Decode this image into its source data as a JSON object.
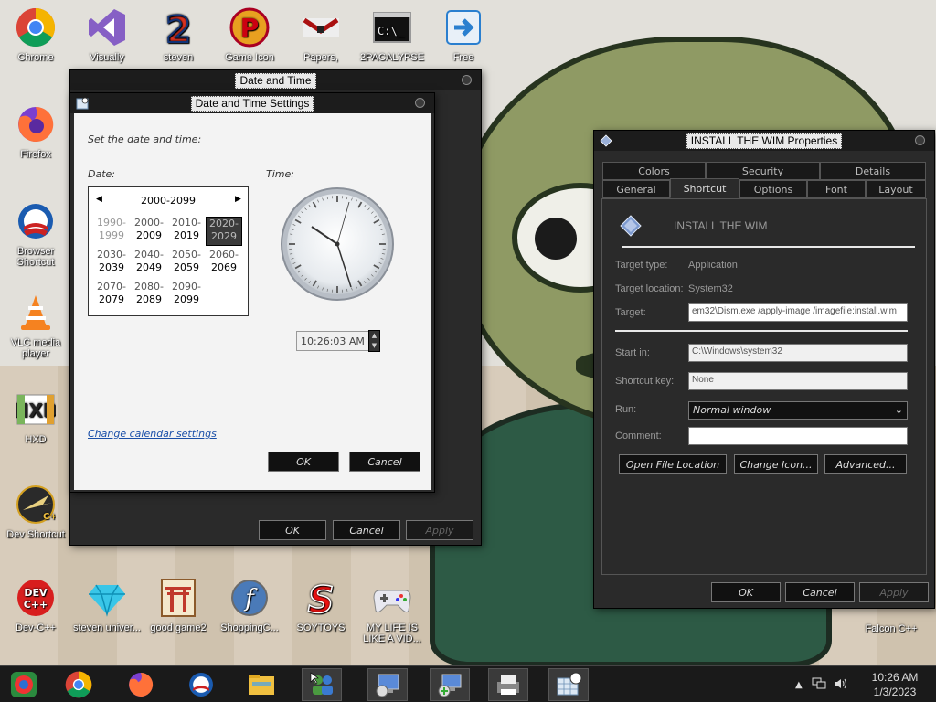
{
  "desktop_icons": [
    {
      "label": "Chrome",
      "icon": "chrome-icon"
    },
    {
      "label": "Visually",
      "icon": "visual-studio-icon"
    },
    {
      "label": "steven",
      "icon": "game-2-icon"
    },
    {
      "label": "Game Icon",
      "icon": "p-game-icon"
    },
    {
      "label": "Papers,",
      "icon": "papers-please-icon"
    },
    {
      "label": "2PACALYPSE",
      "icon": "cmd-icon"
    },
    {
      "label": "Free",
      "icon": "free-arrow-icon"
    },
    {
      "label": "Firefox",
      "icon": "firefox-icon"
    },
    {
      "label": "Browser Shortcut",
      "icon": "obama-icon"
    },
    {
      "label": "VLC media player",
      "icon": "vlc-icon"
    },
    {
      "label": "HXD",
      "icon": "hxd-icon"
    },
    {
      "label": "Dev Shortcut",
      "icon": "c-plus-plus-icon"
    },
    {
      "label": "Dev-C++",
      "icon": "dev-cpp-icon"
    },
    {
      "label": "steven univer...",
      "icon": "gem-icon"
    },
    {
      "label": "good game2",
      "icon": "torii-icon"
    },
    {
      "label": "ShoppingC...",
      "icon": "flash-icon"
    },
    {
      "label": "SOYTOYS",
      "icon": "s-logo-icon"
    },
    {
      "label": "MY LIFE IS LIKE A VID...",
      "icon": "gamepad-icon"
    },
    {
      "label": "Falcon C++",
      "icon": "falcon-icon"
    }
  ],
  "date_time_window": {
    "title": "Date and Time",
    "buttons": {
      "ok": "OK",
      "cancel": "Cancel",
      "apply": "Apply"
    }
  },
  "date_time_settings": {
    "title": "Date and Time Settings",
    "prompt": "Set the date and time:",
    "date_label": "Date:",
    "time_label": "Time:",
    "calendar": {
      "header": "2000-2099",
      "cells": [
        {
          "top": "1990-",
          "bottom": "1999",
          "dim": true
        },
        {
          "top": "2000-",
          "bottom": "2009",
          "dim": false
        },
        {
          "top": "2010-",
          "bottom": "2019",
          "dim": false
        },
        {
          "top": "2020-",
          "bottom": "2029",
          "selected": true
        },
        {
          "top": "2030-",
          "bottom": "2039",
          "dim": false
        },
        {
          "top": "2040-",
          "bottom": "2049",
          "dim": false
        },
        {
          "top": "2050-",
          "bottom": "2059",
          "dim": false
        },
        {
          "top": "2060-",
          "bottom": "2069",
          "dim": false
        },
        {
          "top": "2070-",
          "bottom": "2079",
          "dim": false
        },
        {
          "top": "2080-",
          "bottom": "2089",
          "dim": false
        },
        {
          "top": "2090-",
          "bottom": "2099",
          "dim": false
        }
      ]
    },
    "time_value": "10:26:03 AM",
    "change_link": "Change calendar settings",
    "ok": "OK",
    "cancel": "Cancel"
  },
  "properties_window": {
    "title": "INSTALL THE WIM Properties",
    "tabs_row1": [
      "Colors",
      "Security",
      "Details"
    ],
    "tabs_row2": [
      "General",
      "Shortcut",
      "Options",
      "Font",
      "Layout"
    ],
    "active_tab": "Shortcut",
    "shortcut_name": "INSTALL THE WIM",
    "fields": {
      "target_type_label": "Target type:",
      "target_type": "Application",
      "target_location_label": "Target location:",
      "target_location": "System32",
      "target_label": "Target:",
      "target": "em32\\Dism.exe /apply-image /imagefile:install.wim",
      "start_in_label": "Start in:",
      "start_in": "C:\\Windows\\system32",
      "shortcut_key_label": "Shortcut key:",
      "shortcut_key": "None",
      "run_label": "Run:",
      "run": "Normal window",
      "comment_label": "Comment:",
      "comment": ""
    },
    "buttons": {
      "open_file_location": "Open File Location",
      "change_icon": "Change Icon...",
      "advanced": "Advanced...",
      "ok": "OK",
      "cancel": "Cancel",
      "apply": "Apply"
    }
  },
  "taskbar": {
    "apps": [
      "start-icon",
      "chrome-icon",
      "firefox-icon",
      "obama-icon",
      "file-explorer-icon",
      "network-people-icon",
      "control-panel-icon",
      "network-setup-icon",
      "printer-icon",
      "calendar-clock-icon"
    ],
    "clock_time": "10:26 AM",
    "clock_date": "1/3/2023"
  }
}
